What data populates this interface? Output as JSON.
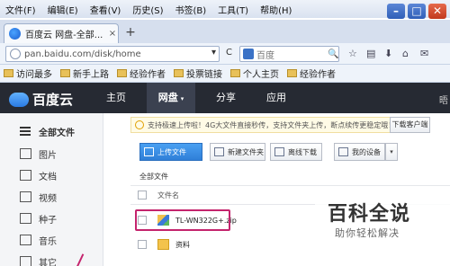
{
  "menu": {
    "items": [
      "文件(F)",
      "编辑(E)",
      "查看(V)",
      "历史(S)",
      "书签(B)",
      "工具(T)",
      "帮助(H)"
    ]
  },
  "window_controls": {
    "minimize": "–",
    "maximize": "□",
    "close": "✕"
  },
  "tab": {
    "title": "百度云 网盘-全部...",
    "close": "×",
    "new": "+"
  },
  "address": {
    "url": "pan.baidu.com/disk/home",
    "dropdown": "▾",
    "reload": "C",
    "search_placeholder": "百度",
    "search_go": "🔍"
  },
  "toolbar_icons": [
    "☆",
    "▤",
    "⬇",
    "⌂",
    "✉"
  ],
  "bookmarks": [
    "访问最多",
    "新手上路",
    "经验作者",
    "投票链接",
    "个人主页",
    "经验作者"
  ],
  "baidu": {
    "logo": "百度云",
    "nav": [
      "主页",
      "网盘",
      "分享",
      "应用"
    ],
    "nav_active": "网盘",
    "nav_caret": "▾",
    "user_initial": "晤"
  },
  "sidebar": {
    "items": [
      {
        "label": "全部文件",
        "icon": "list-icon"
      },
      {
        "label": "图片",
        "icon": "image-icon"
      },
      {
        "label": "文档",
        "icon": "document-icon"
      },
      {
        "label": "视频",
        "icon": "video-icon"
      },
      {
        "label": "种子",
        "icon": "bt-icon"
      },
      {
        "label": "音乐",
        "icon": "music-icon"
      },
      {
        "label": "其它",
        "icon": "other-icon"
      }
    ]
  },
  "notice": {
    "text": "支持极速上传啦！4G大文件直接秒传，支持文件夹上传，断点续传更稳定哦！",
    "download_button": "下载客户端"
  },
  "actions": {
    "upload": "上传文件",
    "new_folder": "新建文件夹",
    "offline_download": "离线下载",
    "my_devices": "我的设备",
    "dropdown": "▾"
  },
  "breadcrumb": "全部文件",
  "file_list": {
    "header": "文件名",
    "rows": [
      {
        "name": "TL-WN322G+.zip",
        "type": "zip"
      },
      {
        "name": "资料",
        "type": "folder"
      }
    ]
  },
  "watermark": {
    "title": "百科全说",
    "subtitle": "助你轻松解决"
  },
  "colors": {
    "accent": "#c4246d",
    "header_bg": "#262a33",
    "primary_button": "#2f7fd8"
  }
}
